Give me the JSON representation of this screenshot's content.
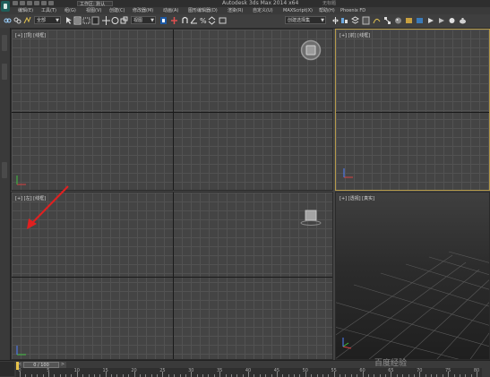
{
  "titlebar": {
    "workspace": "工作区: 默认",
    "window_title": "Autodesk 3ds Max 2014 x64",
    "search_hint": "无标题"
  },
  "menu": {
    "items": [
      "编辑(E)",
      "工具(T)",
      "组(G)",
      "视图(V)",
      "创建(C)",
      "修改器(M)",
      "动画(A)",
      "图形编辑器(D)",
      "渲染(R)",
      "自定义(U)",
      "MAXScript(X)",
      "帮助(H)",
      "Phoenix FD"
    ]
  },
  "toolbar": {
    "selection_filter": "全部",
    "reference_coord": "视图",
    "named_selection": "创建选择集"
  },
  "viewports": {
    "top": {
      "label": "[+] [顶] [线框]"
    },
    "front": {
      "label": "[+] [前] [线框]"
    },
    "left": {
      "label": "[+] [左] [线框]"
    },
    "perspective": {
      "label": "[+] [透视] [真实]"
    }
  },
  "timeline": {
    "slider_label": "0 / 100",
    "ticks": [
      0,
      5,
      10,
      15,
      20,
      25,
      30,
      35,
      40,
      45,
      50,
      55,
      60,
      65,
      70,
      75,
      80
    ],
    "current_frame": 0,
    "total_frames": 100
  },
  "watermark": "百度经验",
  "colors": {
    "active_viewport_border": "#b59a4a",
    "annotation_arrow": "#e02020",
    "viewport_bg": "#444444"
  },
  "icons": {
    "app_logo": "3ds-max-logo-icon",
    "steering_wheel": "steering-wheel-icon",
    "view_cube": "view-cube-icon",
    "axis_tripod": "axis-tripod-icon"
  }
}
